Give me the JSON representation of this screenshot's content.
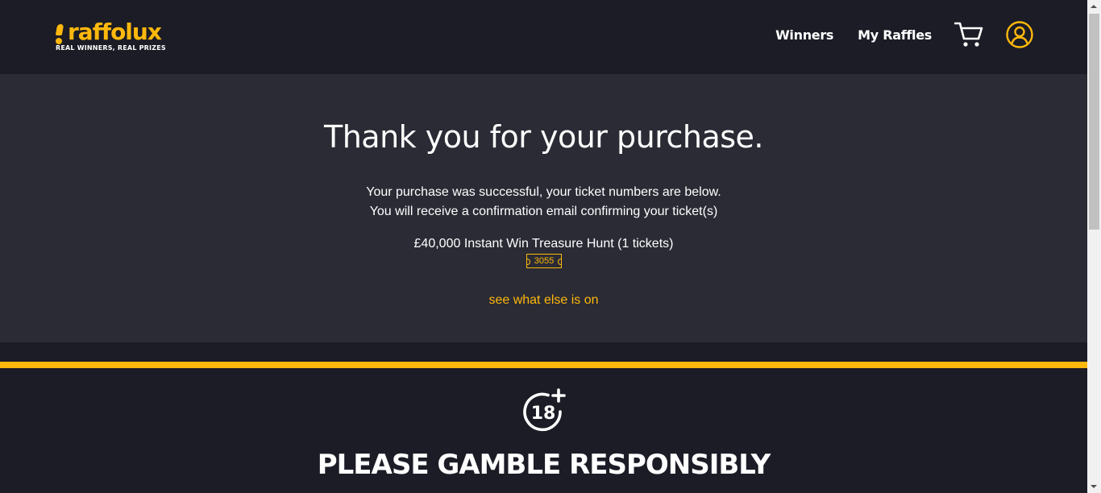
{
  "header": {
    "logo": {
      "name": "raffolux",
      "tagline": "REAL WINNERS, REAL PRIZES"
    },
    "nav": {
      "winners_label": "Winners",
      "my_raffles_label": "My Raffles",
      "cart_icon": "shopping-cart-icon",
      "account_icon": "user-account-icon"
    }
  },
  "main": {
    "title": "Thank you for your purchase.",
    "message_line1": "Your purchase was successful, your ticket numbers are below.",
    "message_line2": "You will receive a confirmation email confirming your ticket(s)",
    "raffle_title": "£40,000 Instant Win Treasure Hunt (1 tickets)",
    "ticket_number": "3055",
    "see_more_link": "see what else is on"
  },
  "footer": {
    "age_badge_icon": "18-plus-icon",
    "age_badge_text": "18",
    "gamble_message": "PLEASE GAMBLE RESPONSIBLY"
  },
  "colors": {
    "accent": "#ffb80c",
    "header_bg": "#1b1c26",
    "main_bg": "#2a2b35",
    "text": "#ffffff"
  }
}
